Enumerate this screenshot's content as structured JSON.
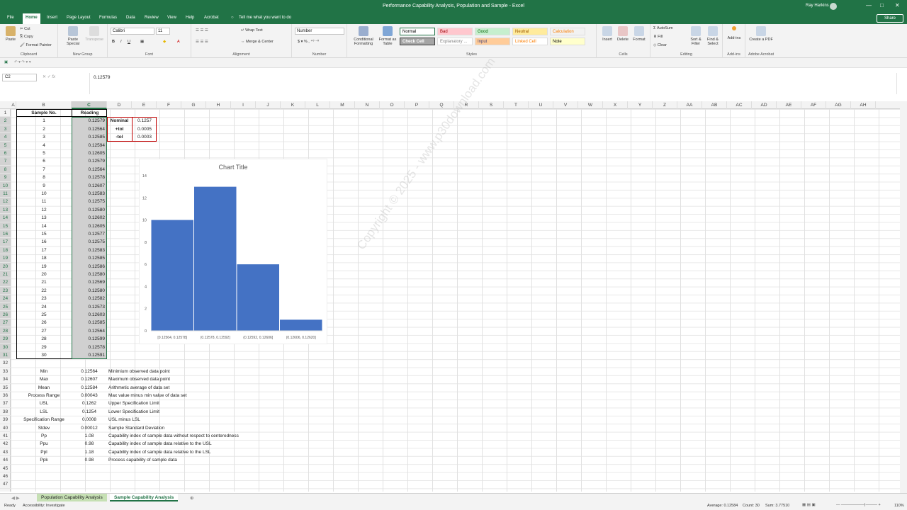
{
  "window": {
    "title": "Performance Capability Analysis, Population and Sample  -  Excel",
    "user": "Ray Harkins",
    "controls": [
      "—",
      "□",
      "✕"
    ]
  },
  "ribbon_tabs": [
    "File",
    "Home",
    "Insert",
    "Page Layout",
    "Formulas",
    "Data",
    "Review",
    "View",
    "Help",
    "Acrobat"
  ],
  "active_tab": "Home",
  "tell_me": "Tell me what you want to do",
  "share": "Share",
  "clipboard": {
    "paste": "Paste",
    "cut": "Cut",
    "copy": "Copy",
    "format_painter": "Format Painter",
    "label": "Clipboard"
  },
  "new_group": {
    "paste_special": "Paste Special",
    "transpose": "Transpose",
    "label": "New Group"
  },
  "font": {
    "name": "Calibri",
    "size": "11",
    "label": "Font"
  },
  "alignment": {
    "wrap": "Wrap Text",
    "merge": "Merge & Center",
    "label": "Alignment"
  },
  "number": {
    "format": "Number",
    "label": "Number"
  },
  "styles": {
    "conditional": "Conditional Formatting",
    "format_table": "Format as Table",
    "label": "Styles",
    "items": [
      {
        "t": "Normal",
        "bg": "#ffffff",
        "c": "#000000"
      },
      {
        "t": "Bad",
        "bg": "#ffc7ce",
        "c": "#9c0006"
      },
      {
        "t": "Good",
        "bg": "#c6efce",
        "c": "#006100"
      },
      {
        "t": "Neutral",
        "bg": "#ffeb9c",
        "c": "#9c5700"
      },
      {
        "t": "Calculation",
        "bg": "#f2f2f2",
        "c": "#fa7d00"
      },
      {
        "t": "Check Cell",
        "bg": "#a5a5a5",
        "c": "#ffffff"
      },
      {
        "t": "Explanatory ...",
        "bg": "#ffffff",
        "c": "#7f7f7f"
      },
      {
        "t": "Input",
        "bg": "#ffcc99",
        "c": "#3f3f76"
      },
      {
        "t": "Linked Cell",
        "bg": "#ffffff",
        "c": "#fa7d00"
      },
      {
        "t": "Note",
        "bg": "#ffffcc",
        "c": "#000000"
      }
    ]
  },
  "cells_group": {
    "insert": "Insert",
    "delete": "Delete",
    "format": "Format",
    "label": "Cells"
  },
  "editing": {
    "autosum": "AutoSum",
    "fill": "Fill",
    "clear": "Clear",
    "sort": "Sort & Filter",
    "find": "Find & Select",
    "label": "Editing"
  },
  "addins": {
    "label": "Add-ins",
    "btn": "Add-ins"
  },
  "acrobat": {
    "btn": "Create a PDF",
    "label": "Adobe Acrobat"
  },
  "formula_bar": {
    "name_box": "C2",
    "fx": "fx",
    "value": "0.12579"
  },
  "columns": [
    "A",
    "B",
    "C",
    "D",
    "E",
    "F",
    "G",
    "H",
    "I",
    "J",
    "K",
    "L",
    "M",
    "N",
    "O",
    "P",
    "Q",
    "R",
    "S",
    "T",
    "U",
    "V",
    "W",
    "X",
    "Y",
    "Z",
    "AA",
    "AB",
    "AC",
    "AD",
    "AE",
    "AF",
    "AG",
    "AH"
  ],
  "rows": 47,
  "table": {
    "headers": [
      "Sample No.",
      "Reading"
    ],
    "data": [
      [
        "1",
        "0.12579"
      ],
      [
        "2",
        "0.12564"
      ],
      [
        "3",
        "0.12585"
      ],
      [
        "4",
        "0.12594"
      ],
      [
        "5",
        "0.12605"
      ],
      [
        "6",
        "0.12579"
      ],
      [
        "7",
        "0.12564"
      ],
      [
        "8",
        "0.12578"
      ],
      [
        "9",
        "0.12607"
      ],
      [
        "10",
        "0.12583"
      ],
      [
        "11",
        "0.12575"
      ],
      [
        "12",
        "0.12580"
      ],
      [
        "13",
        "0.12602"
      ],
      [
        "14",
        "0.12605"
      ],
      [
        "15",
        "0.12577"
      ],
      [
        "16",
        "0.12575"
      ],
      [
        "17",
        "0.12583"
      ],
      [
        "18",
        "0.12585"
      ],
      [
        "19",
        "0.12586"
      ],
      [
        "20",
        "0.12580"
      ],
      [
        "21",
        "0.12569"
      ],
      [
        "22",
        "0.12580"
      ],
      [
        "23",
        "0.12582"
      ],
      [
        "24",
        "0.12573"
      ],
      [
        "25",
        "0.12603"
      ],
      [
        "26",
        "0.12585"
      ],
      [
        "27",
        "0.12564"
      ],
      [
        "28",
        "0.12599"
      ],
      [
        "29",
        "0.12578"
      ],
      [
        "30",
        "0.12591"
      ]
    ]
  },
  "spec": [
    [
      "Nominal",
      "0.1257"
    ],
    [
      "+tol",
      "0.0005"
    ],
    [
      "-tol",
      "0.0003"
    ]
  ],
  "stats": [
    [
      "Min",
      "0.12564",
      "Minimium observed data point"
    ],
    [
      "Max",
      "0.12607",
      "Maximum observed data point"
    ],
    [
      "Mean",
      "0.12584",
      "Arithmetic average of data set"
    ],
    [
      "Process Range",
      "0.00043",
      "Max value minus min value of data set"
    ],
    [
      "USL",
      "0.1262",
      "Upper Specification Limit"
    ],
    [
      "LSL",
      "0.1254",
      "Lower Specification Limit"
    ],
    [
      "Specification Range",
      "0.0008",
      "USL minus LSL"
    ],
    [
      "Stdev",
      "0.00012",
      "Sample Standard Deviation"
    ],
    [
      "Pp",
      "1.08",
      "Capability index of sample data without respect to centeredness"
    ],
    [
      "Ppu",
      "0.98",
      "Capability index of sample data relative to the USL"
    ],
    [
      "Ppl",
      "1.18",
      "Capability index of sample data relative to the LSL"
    ],
    [
      "Ppk",
      "0.98",
      "Process capability of sample data"
    ]
  ],
  "chart_data": {
    "type": "bar",
    "title": "Chart Title",
    "categories": [
      "[0.12564, 0.12578]",
      "(0.12578, 0.12592]",
      "(0.12592, 0.12606]",
      "(0.12606, 0.12620]"
    ],
    "values": [
      10,
      13,
      6,
      1
    ],
    "ylim": [
      0,
      14
    ],
    "yticks": [
      0,
      2,
      4,
      6,
      8,
      10,
      12,
      14
    ],
    "color": "#4472c4",
    "grid": false,
    "legend": "none"
  },
  "sheets": [
    "Population Capability Analysis",
    "Sample Capability Analysis"
  ],
  "active_sheet": "Sample Capability Analysis",
  "status": {
    "ready": "Ready",
    "accessibility": "Accessibility: Investigate",
    "average": "Average: 0.12584",
    "count": "Count: 30",
    "sum": "Sum: 3.77510",
    "zoom": "110%"
  },
  "watermark": "Copyright © 2025 - www.p30download.com"
}
